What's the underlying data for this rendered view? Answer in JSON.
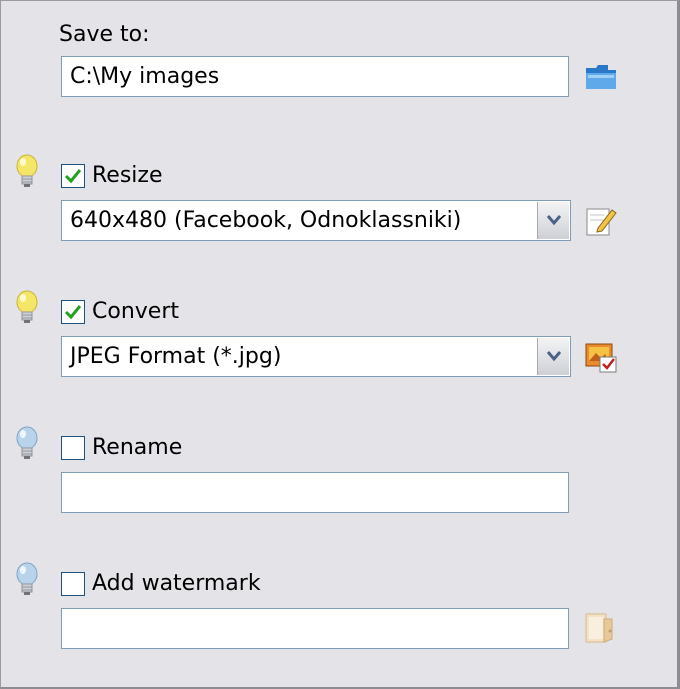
{
  "save_to": {
    "label": "Save to:",
    "path": "C:\\My images",
    "browse_icon": "folder-icon"
  },
  "resize": {
    "label": "Resize",
    "checked": true,
    "selected": "640x480 (Facebook, Odnoklassniki)",
    "hint_icon": "lightbulb-on-icon",
    "edit_icon": "edit-pencil-icon"
  },
  "convert": {
    "label": "Convert",
    "checked": true,
    "selected": "JPEG Format (*.jpg)",
    "hint_icon": "lightbulb-on-icon",
    "settings_icon": "format-settings-icon"
  },
  "rename": {
    "label": "Rename",
    "checked": false,
    "value": "",
    "hint_icon": "lightbulb-off-icon"
  },
  "watermark": {
    "label": "Add watermark",
    "checked": false,
    "value": "",
    "hint_icon": "lightbulb-off-icon",
    "browse_icon": "watermark-browse-icon"
  },
  "colors": {
    "panel_bg": "#e4e3e8",
    "field_border": "#7f9db9",
    "check_mark": "#21a121",
    "bulb_on": "#f5e66a",
    "bulb_off": "#b9d4ea"
  }
}
